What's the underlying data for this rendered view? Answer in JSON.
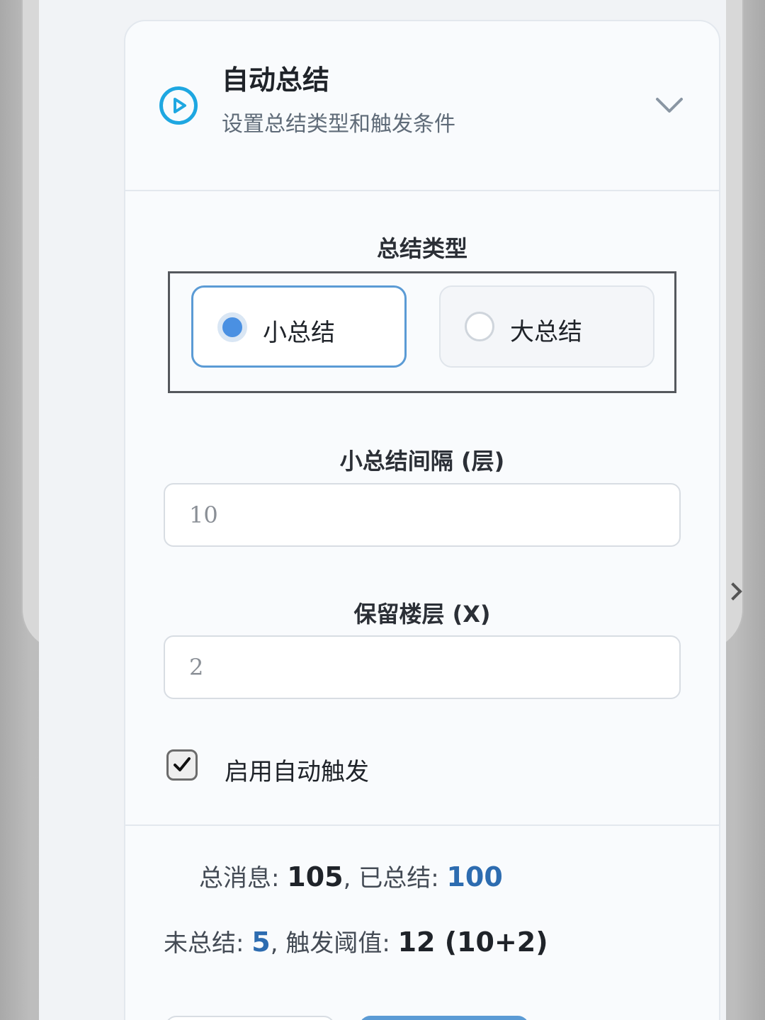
{
  "panel": {
    "title": "自动总结",
    "subtitle": "设置总结类型和触发条件",
    "icon": "play-circle-icon",
    "accent_color": "#1ea7e1"
  },
  "summary_type": {
    "label": "总结类型",
    "options": [
      {
        "label": "小总结",
        "selected": true
      },
      {
        "label": "大总结",
        "selected": false
      }
    ]
  },
  "small_interval": {
    "label": "小总结间隔 (层)",
    "value": "10"
  },
  "keep_floors": {
    "label": "保留楼层 (X)",
    "value": "2"
  },
  "auto_trigger": {
    "label": "启用自动触发",
    "checked": true
  },
  "stats": {
    "total_label": "总消息: ",
    "total_value": "105",
    "summarized_label": ", 已总结: ",
    "summarized_value": "100",
    "unsummarized_label": "未总结: ",
    "unsummarized_value": "5",
    "threshold_label": ", 触发阈值: ",
    "threshold_value": "12 (10+2)"
  }
}
